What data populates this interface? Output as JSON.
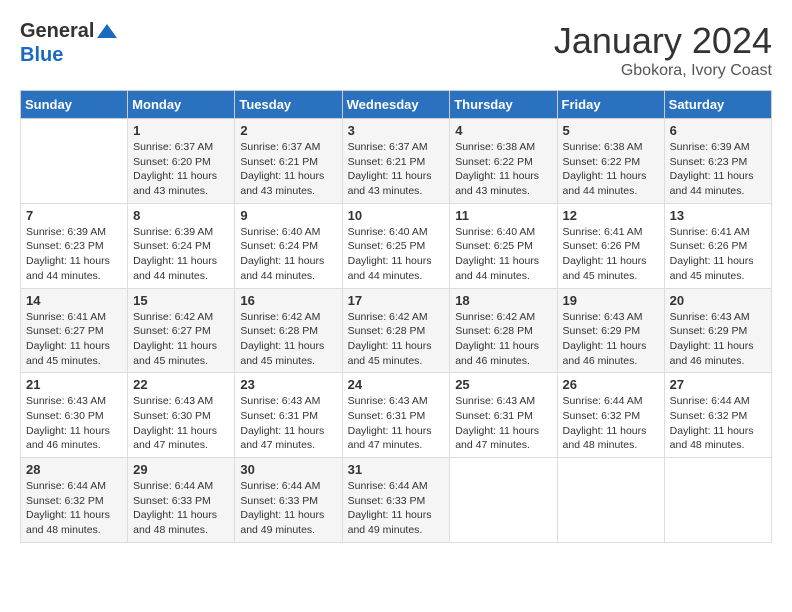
{
  "header": {
    "logo_general": "General",
    "logo_blue": "Blue",
    "month_year": "January 2024",
    "location": "Gbokora, Ivory Coast"
  },
  "weekdays": [
    "Sunday",
    "Monday",
    "Tuesday",
    "Wednesday",
    "Thursday",
    "Friday",
    "Saturday"
  ],
  "weeks": [
    [
      {
        "day": "",
        "sunrise": "",
        "sunset": "",
        "daylight": ""
      },
      {
        "day": "1",
        "sunrise": "Sunrise: 6:37 AM",
        "sunset": "Sunset: 6:20 PM",
        "daylight": "Daylight: 11 hours and 43 minutes."
      },
      {
        "day": "2",
        "sunrise": "Sunrise: 6:37 AM",
        "sunset": "Sunset: 6:21 PM",
        "daylight": "Daylight: 11 hours and 43 minutes."
      },
      {
        "day": "3",
        "sunrise": "Sunrise: 6:37 AM",
        "sunset": "Sunset: 6:21 PM",
        "daylight": "Daylight: 11 hours and 43 minutes."
      },
      {
        "day": "4",
        "sunrise": "Sunrise: 6:38 AM",
        "sunset": "Sunset: 6:22 PM",
        "daylight": "Daylight: 11 hours and 43 minutes."
      },
      {
        "day": "5",
        "sunrise": "Sunrise: 6:38 AM",
        "sunset": "Sunset: 6:22 PM",
        "daylight": "Daylight: 11 hours and 44 minutes."
      },
      {
        "day": "6",
        "sunrise": "Sunrise: 6:39 AM",
        "sunset": "Sunset: 6:23 PM",
        "daylight": "Daylight: 11 hours and 44 minutes."
      }
    ],
    [
      {
        "day": "7",
        "sunrise": "Sunrise: 6:39 AM",
        "sunset": "Sunset: 6:23 PM",
        "daylight": "Daylight: 11 hours and 44 minutes."
      },
      {
        "day": "8",
        "sunrise": "Sunrise: 6:39 AM",
        "sunset": "Sunset: 6:24 PM",
        "daylight": "Daylight: 11 hours and 44 minutes."
      },
      {
        "day": "9",
        "sunrise": "Sunrise: 6:40 AM",
        "sunset": "Sunset: 6:24 PM",
        "daylight": "Daylight: 11 hours and 44 minutes."
      },
      {
        "day": "10",
        "sunrise": "Sunrise: 6:40 AM",
        "sunset": "Sunset: 6:25 PM",
        "daylight": "Daylight: 11 hours and 44 minutes."
      },
      {
        "day": "11",
        "sunrise": "Sunrise: 6:40 AM",
        "sunset": "Sunset: 6:25 PM",
        "daylight": "Daylight: 11 hours and 44 minutes."
      },
      {
        "day": "12",
        "sunrise": "Sunrise: 6:41 AM",
        "sunset": "Sunset: 6:26 PM",
        "daylight": "Daylight: 11 hours and 45 minutes."
      },
      {
        "day": "13",
        "sunrise": "Sunrise: 6:41 AM",
        "sunset": "Sunset: 6:26 PM",
        "daylight": "Daylight: 11 hours and 45 minutes."
      }
    ],
    [
      {
        "day": "14",
        "sunrise": "Sunrise: 6:41 AM",
        "sunset": "Sunset: 6:27 PM",
        "daylight": "Daylight: 11 hours and 45 minutes."
      },
      {
        "day": "15",
        "sunrise": "Sunrise: 6:42 AM",
        "sunset": "Sunset: 6:27 PM",
        "daylight": "Daylight: 11 hours and 45 minutes."
      },
      {
        "day": "16",
        "sunrise": "Sunrise: 6:42 AM",
        "sunset": "Sunset: 6:28 PM",
        "daylight": "Daylight: 11 hours and 45 minutes."
      },
      {
        "day": "17",
        "sunrise": "Sunrise: 6:42 AM",
        "sunset": "Sunset: 6:28 PM",
        "daylight": "Daylight: 11 hours and 45 minutes."
      },
      {
        "day": "18",
        "sunrise": "Sunrise: 6:42 AM",
        "sunset": "Sunset: 6:28 PM",
        "daylight": "Daylight: 11 hours and 46 minutes."
      },
      {
        "day": "19",
        "sunrise": "Sunrise: 6:43 AM",
        "sunset": "Sunset: 6:29 PM",
        "daylight": "Daylight: 11 hours and 46 minutes."
      },
      {
        "day": "20",
        "sunrise": "Sunrise: 6:43 AM",
        "sunset": "Sunset: 6:29 PM",
        "daylight": "Daylight: 11 hours and 46 minutes."
      }
    ],
    [
      {
        "day": "21",
        "sunrise": "Sunrise: 6:43 AM",
        "sunset": "Sunset: 6:30 PM",
        "daylight": "Daylight: 11 hours and 46 minutes."
      },
      {
        "day": "22",
        "sunrise": "Sunrise: 6:43 AM",
        "sunset": "Sunset: 6:30 PM",
        "daylight": "Daylight: 11 hours and 47 minutes."
      },
      {
        "day": "23",
        "sunrise": "Sunrise: 6:43 AM",
        "sunset": "Sunset: 6:31 PM",
        "daylight": "Daylight: 11 hours and 47 minutes."
      },
      {
        "day": "24",
        "sunrise": "Sunrise: 6:43 AM",
        "sunset": "Sunset: 6:31 PM",
        "daylight": "Daylight: 11 hours and 47 minutes."
      },
      {
        "day": "25",
        "sunrise": "Sunrise: 6:43 AM",
        "sunset": "Sunset: 6:31 PM",
        "daylight": "Daylight: 11 hours and 47 minutes."
      },
      {
        "day": "26",
        "sunrise": "Sunrise: 6:44 AM",
        "sunset": "Sunset: 6:32 PM",
        "daylight": "Daylight: 11 hours and 48 minutes."
      },
      {
        "day": "27",
        "sunrise": "Sunrise: 6:44 AM",
        "sunset": "Sunset: 6:32 PM",
        "daylight": "Daylight: 11 hours and 48 minutes."
      }
    ],
    [
      {
        "day": "28",
        "sunrise": "Sunrise: 6:44 AM",
        "sunset": "Sunset: 6:32 PM",
        "daylight": "Daylight: 11 hours and 48 minutes."
      },
      {
        "day": "29",
        "sunrise": "Sunrise: 6:44 AM",
        "sunset": "Sunset: 6:33 PM",
        "daylight": "Daylight: 11 hours and 48 minutes."
      },
      {
        "day": "30",
        "sunrise": "Sunrise: 6:44 AM",
        "sunset": "Sunset: 6:33 PM",
        "daylight": "Daylight: 11 hours and 49 minutes."
      },
      {
        "day": "31",
        "sunrise": "Sunrise: 6:44 AM",
        "sunset": "Sunset: 6:33 PM",
        "daylight": "Daylight: 11 hours and 49 minutes."
      },
      {
        "day": "",
        "sunrise": "",
        "sunset": "",
        "daylight": ""
      },
      {
        "day": "",
        "sunrise": "",
        "sunset": "",
        "daylight": ""
      },
      {
        "day": "",
        "sunrise": "",
        "sunset": "",
        "daylight": ""
      }
    ]
  ]
}
